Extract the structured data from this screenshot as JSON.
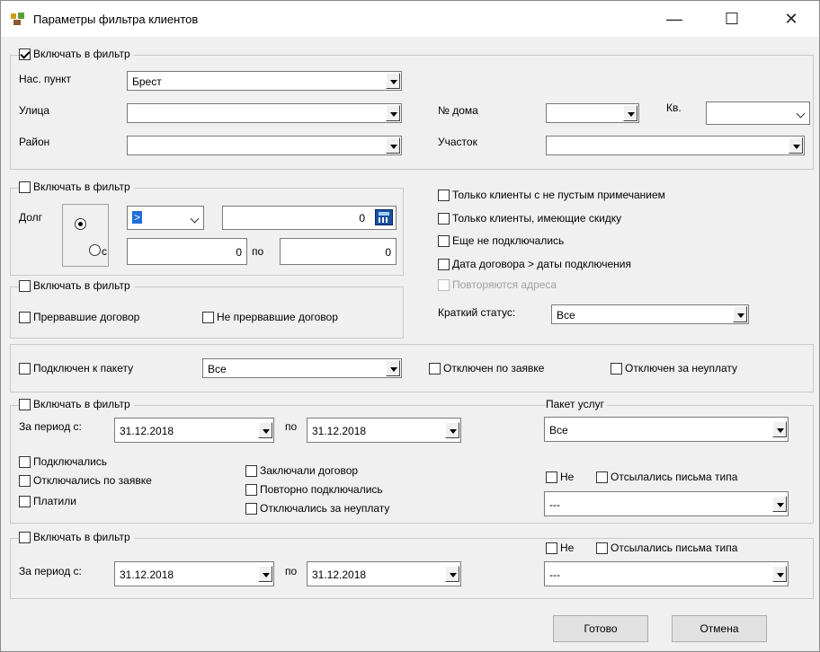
{
  "window": {
    "title": "Параметры фильтра клиентов",
    "minimize": "—",
    "maximize": "☐",
    "close": "✕"
  },
  "address": {
    "include_label": "Включать в фильтр",
    "include_checked": true,
    "city_label": "Нас. пункт",
    "city_value": "Брест",
    "street_label": "Улица",
    "street_value": "",
    "district_label": "Район",
    "district_value": "",
    "house_label": "№ дома",
    "house_value": "",
    "apt_label": "Кв.",
    "apt_value": "",
    "section_label": "Участок",
    "section_value": ""
  },
  "debt": {
    "include_label": "Включать в фильтр",
    "debt_label": "Долг",
    "operator_value": ">",
    "amount_value": "0",
    "range_from_label": "с",
    "range_from_value": "0",
    "range_to_label": "по",
    "range_to_value": "0"
  },
  "contract": {
    "include_label": "Включать в фильтр",
    "terminated_label": "Прервавшие договор",
    "not_terminated_label": "Не прервавшие договор"
  },
  "flags": {
    "note_label": "Только клиенты с не пустым примечанием",
    "discount_label": "Только клиенты, имеющие скидку",
    "not_connected_label": "Еще не подключались",
    "contract_date_label": "Дата договора > даты подключения",
    "repeat_address_label": "Повторяются адреса",
    "status_label": "Краткий статус:",
    "status_value": "Все"
  },
  "package": {
    "connected_label": "Подключен к пакету",
    "package_value": "Все",
    "disconnected_request_label": "Отключен по заявке",
    "disconnected_nonpay_label": "Отключен за неуплату"
  },
  "period1": {
    "include_label": "Включать в фильтр",
    "from_label": "За период с:",
    "from_value": "31.12.2018",
    "to_label": "по",
    "to_value": "31.12.2018",
    "connected_label": "Подключались",
    "disconnected_request_label": "Отключались по заявке",
    "paid_label": "Платили",
    "contract_label": "Заключали договор",
    "reconnected_label": "Повторно подключались",
    "disconnected_nonpay_label": "Отключались за неуплату",
    "services_label": "Пакет услуг",
    "services_value": "Все",
    "not_label": "Не",
    "letters_label": "Отсылались письма типа",
    "letters_value": "---"
  },
  "period2": {
    "include_label": "Включать в фильтр",
    "from_label": "За период с:",
    "from_value": "31.12.2018",
    "to_label": "по",
    "to_value": "31.12.2018",
    "not_label": "Не",
    "letters_label": "Отсылались письма типа",
    "letters_value": "---"
  },
  "buttons": {
    "ok": "Готово",
    "cancel": "Отмена"
  }
}
